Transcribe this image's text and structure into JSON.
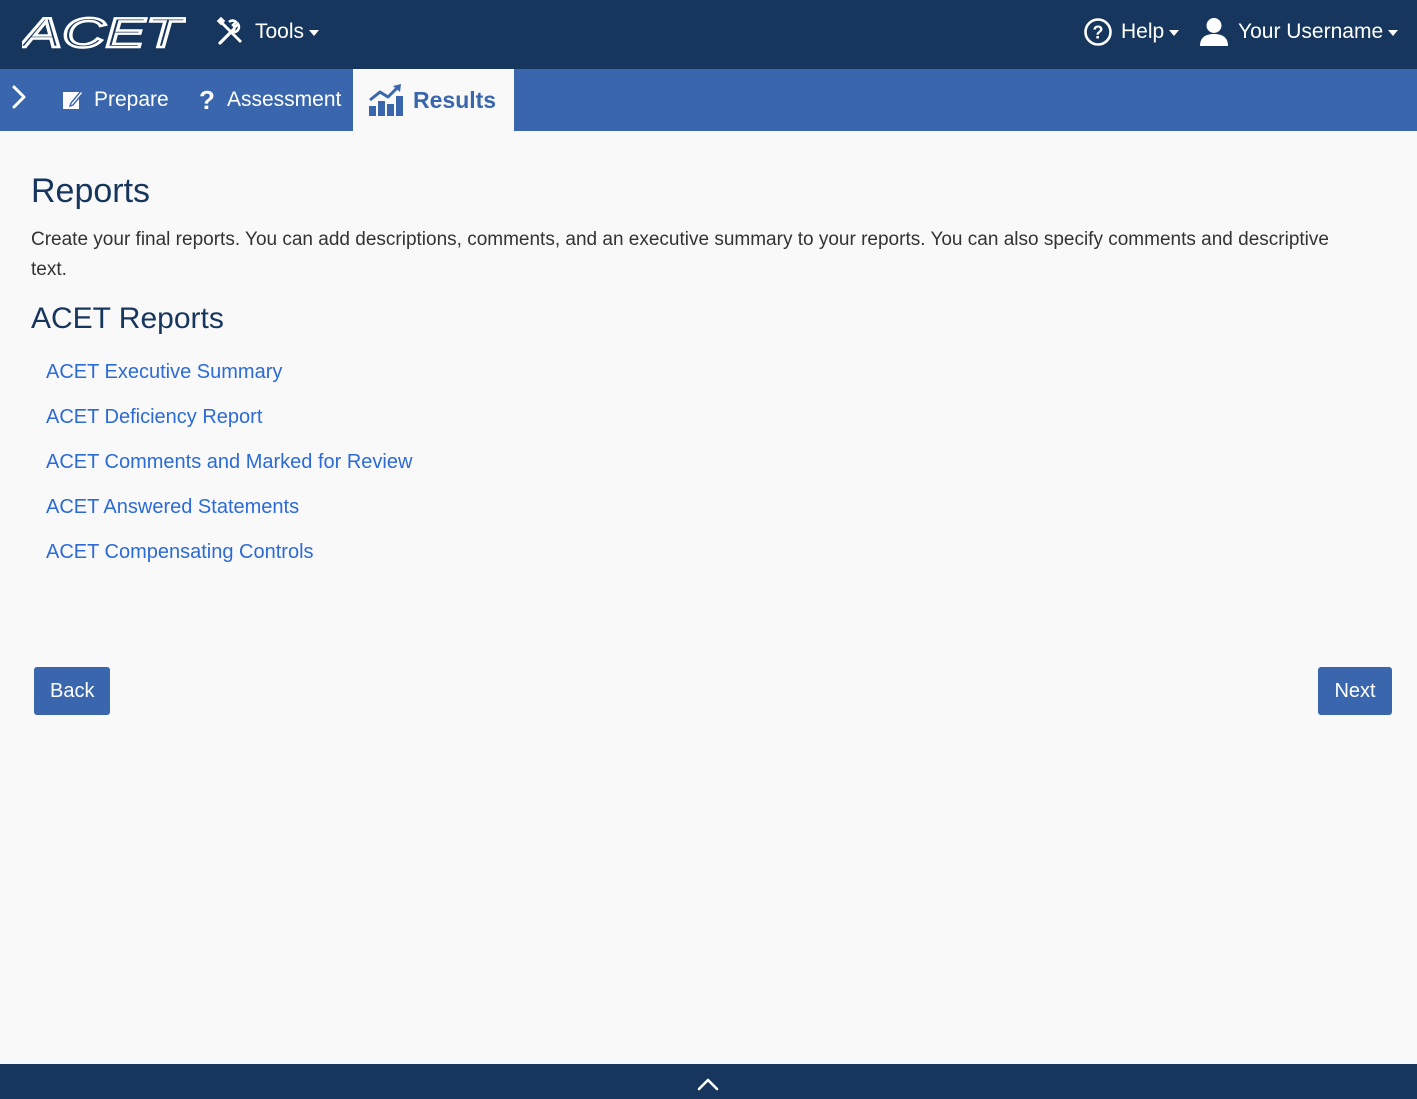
{
  "header": {
    "logo_text": "ACET",
    "tools_label": "Tools",
    "help_label": "Help",
    "user_label": "Your Username"
  },
  "phases": {
    "tabs": [
      {
        "label": "Prepare",
        "icon": "edit-icon"
      },
      {
        "label": "Assessment",
        "icon": "question-icon"
      },
      {
        "label": "Results",
        "icon": "chart-icon",
        "active": true
      }
    ]
  },
  "main": {
    "title": "Reports",
    "intro": "Create your final reports. You can add descriptions, comments, and an executive summary to your reports. You can also specify comments and descriptive text.",
    "section_title": "ACET Reports",
    "reports": [
      "ACET Executive Summary",
      "ACET Deficiency Report",
      "ACET Comments and Marked for Review",
      "ACET Answered Statements",
      "ACET Compensating Controls"
    ]
  },
  "buttons": {
    "back": "Back",
    "next": "Next"
  },
  "colors": {
    "navbar": "#17365d",
    "phasebar": "#3a66ad",
    "link": "#2c6bd6",
    "background": "#f9f9f9"
  }
}
